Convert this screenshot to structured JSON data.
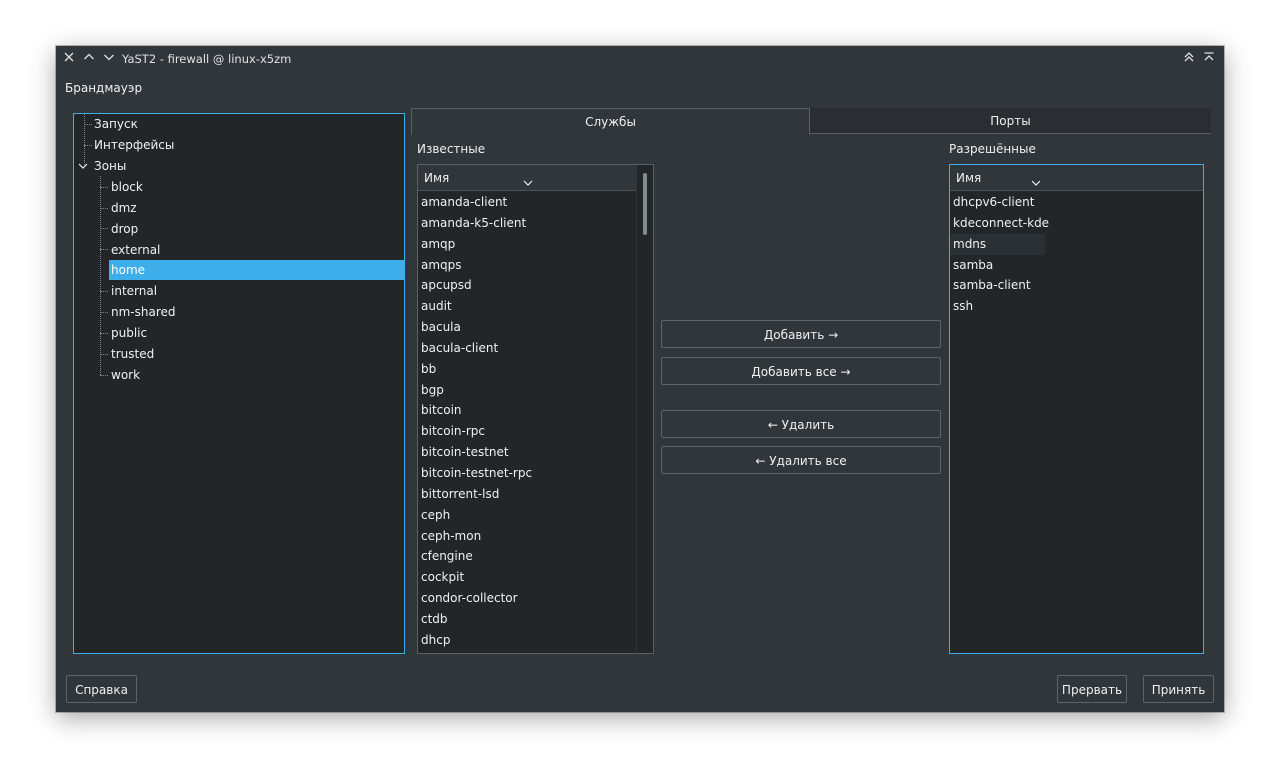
{
  "window": {
    "title": "YaST2 - firewall @ linux-x5zm"
  },
  "section_label": "Брандмауэр",
  "tree": {
    "items": [
      {
        "label": "Запуск"
      },
      {
        "label": "Интерфейсы"
      },
      {
        "label": "Зоны"
      }
    ],
    "zones": [
      {
        "label": "block"
      },
      {
        "label": "dmz"
      },
      {
        "label": "drop"
      },
      {
        "label": "external"
      },
      {
        "label": "home"
      },
      {
        "label": "internal"
      },
      {
        "label": "nm-shared"
      },
      {
        "label": "public"
      },
      {
        "label": "trusted"
      },
      {
        "label": "work"
      }
    ],
    "selected_zone": "home"
  },
  "tabs": [
    {
      "label": "Службы"
    },
    {
      "label": "Порты"
    }
  ],
  "active_tab": "Службы",
  "known": {
    "label": "Известные",
    "header": "Имя",
    "items": [
      "amanda-client",
      "amanda-k5-client",
      "amqp",
      "amqps",
      "apcupsd",
      "audit",
      "bacula",
      "bacula-client",
      "bb",
      "bgp",
      "bitcoin",
      "bitcoin-rpc",
      "bitcoin-testnet",
      "bitcoin-testnet-rpc",
      "bittorrent-lsd",
      "ceph",
      "ceph-mon",
      "cfengine",
      "cockpit",
      "condor-collector",
      "ctdb",
      "dhcp"
    ]
  },
  "allowed": {
    "label": "Разрешённые",
    "header": "Имя",
    "items": [
      "dhcpv6-client",
      "kdeconnect-kde",
      "mdns",
      "samba",
      "samba-client",
      "ssh"
    ]
  },
  "actions": {
    "add": "Добавить →",
    "add_all": "Добавить все →",
    "remove": "← Удалить",
    "remove_all": "← Удалить все"
  },
  "footer": {
    "help": "Справка",
    "abort": "Прервать",
    "accept": "Принять"
  },
  "colors": {
    "accent": "#3daee9",
    "window_bg": "#31363b",
    "view_bg": "#232629"
  }
}
